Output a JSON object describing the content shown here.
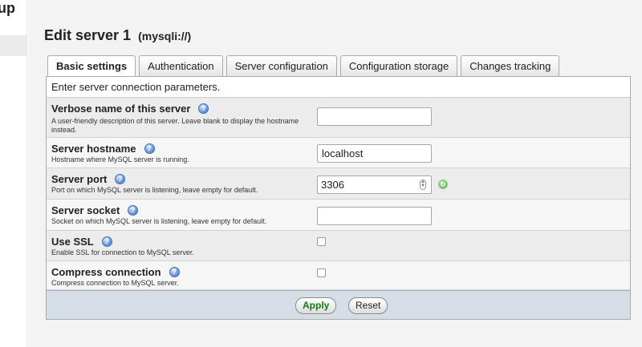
{
  "sidebar": {
    "brand_fragment": "up"
  },
  "page": {
    "title": "Edit server 1",
    "subtitle": "(mysqli://)"
  },
  "tabs": [
    {
      "label": "Basic settings",
      "active": true
    },
    {
      "label": "Authentication",
      "active": false
    },
    {
      "label": "Server configuration",
      "active": false
    },
    {
      "label": "Configuration storage",
      "active": false
    },
    {
      "label": "Changes tracking",
      "active": false
    }
  ],
  "panel": {
    "description": "Enter server connection parameters."
  },
  "fields": {
    "verbose": {
      "label": "Verbose name of this server",
      "desc": "A user-friendly description of this server. Leave blank to display the hostname instead.",
      "value": ""
    },
    "host": {
      "label": "Server hostname",
      "desc": "Hostname where MySQL server is running.",
      "value": "localhost"
    },
    "port": {
      "label": "Server port",
      "desc": "Port on which MySQL server is listening, leave empty for default.",
      "value": "3306"
    },
    "socket": {
      "label": "Server socket",
      "desc": "Socket on which MySQL server is listening, leave empty for default.",
      "value": ""
    },
    "ssl": {
      "label": "Use SSL",
      "desc": "Enable SSL for connection to MySQL server.",
      "checked": false
    },
    "compress": {
      "label": "Compress connection",
      "desc": "Compress connection to MySQL server.",
      "checked": false
    }
  },
  "footer": {
    "apply_label": "Apply",
    "reset_label": "Reset"
  },
  "icons": {
    "help": "help-icon",
    "restore": "restore-default-icon",
    "spinner": "spinner-arrows-icon"
  },
  "colors": {
    "apply_text": "#157a16",
    "footer_bg": "#d5dde6",
    "help_icon": "#5b8ed8"
  }
}
